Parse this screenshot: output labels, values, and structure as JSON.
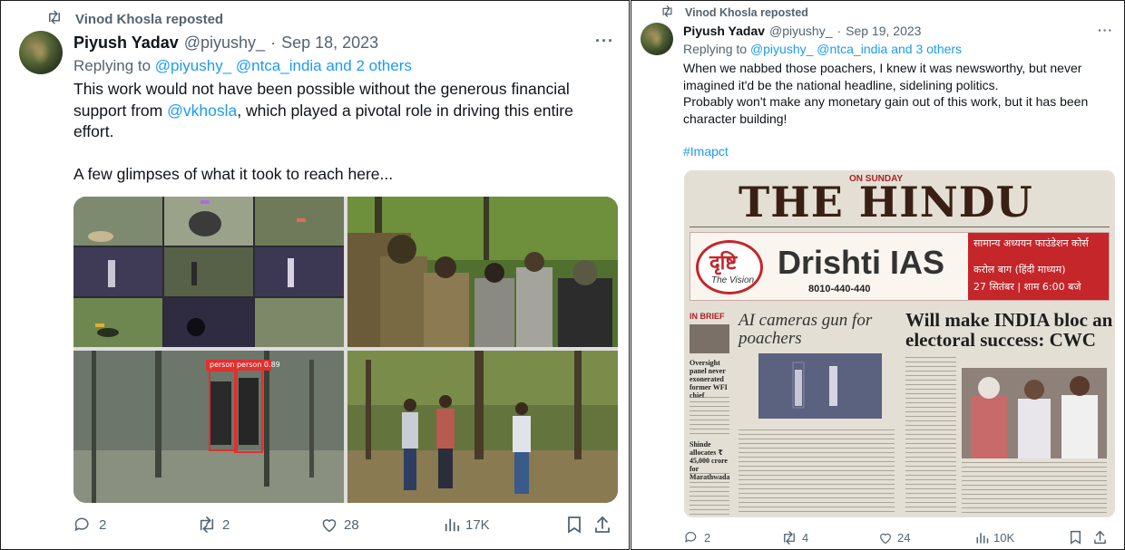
{
  "left_tweet": {
    "reposted_by": "Vinod Khosla reposted",
    "author_name": "Piyush Yadav",
    "author_handle": "@piyushy_",
    "dot": "·",
    "date": "Sep 18, 2023",
    "more": "···",
    "replying_prefix": "Replying to",
    "replying_to": "@piyushy_ @ntca_india and 2 others",
    "text_part1": "This work would not have been possible without the generous financial support from ",
    "mention": "@vkhosla",
    "text_part2": ", which played a pivotal role in driving this entire effort.",
    "text_para2": "A few glimpses of what it took to reach here...",
    "detection_label": "person  person  0.89",
    "stats": {
      "replies": "2",
      "reposts": "2",
      "likes": "28",
      "views": "17K"
    }
  },
  "right_tweet": {
    "reposted_by": "Vinod Khosla reposted",
    "author_name": "Piyush Yadav",
    "author_handle": "@piyushy_",
    "dot": "·",
    "date": "Sep 19, 2023",
    "more": "···",
    "replying_prefix": "Replying to",
    "replying_to": "@piyushy_ @ntca_india and 3 others",
    "text_line1": "When we nabbed those poachers, I knew it was newsworthy, but never imagined it'd be the national headline, sidelining politics.",
    "text_line2": "Probably won't make any monetary gain out of this work, but it has been character building!",
    "hashtag": "#Imapct",
    "newspaper": {
      "masthead": "THE HINDU",
      "edition": "ON SUNDAY",
      "ad_logo_hindi": "दृष्टि",
      "ad_logo_tag": "The Vision",
      "ad_brand": "Drishti IAS",
      "ad_phone": "8010-440-440",
      "ad_right_line1": "सामान्य अध्ययन फाउंडेशन कोर्स",
      "ad_right_line2": "करोल बाग (हिंदी माध्यम)",
      "ad_right_line3": "27 सितंबर | शाम 6:00 बजे",
      "in_brief": "IN BRIEF",
      "brief1": "Oversight panel never exonerated former WFI chief",
      "brief2": "Shinde allocates ₹ 45,000 crore for Marathwada",
      "headline1": "AI cameras gun for poachers",
      "headline2": "Will make INDIA bloc an electoral success: CWC"
    },
    "stats": {
      "replies": "2",
      "reposts": "4",
      "likes": "24",
      "views": "10K"
    }
  },
  "colors": {
    "link": "#1d9bf0",
    "muted": "#536471",
    "text": "#0f1419",
    "detection_red": "#e03030"
  },
  "icons": [
    "retweet-icon",
    "reply-icon",
    "repost-icon",
    "like-icon",
    "views-icon",
    "bookmark-icon",
    "share-icon",
    "more-icon"
  ]
}
